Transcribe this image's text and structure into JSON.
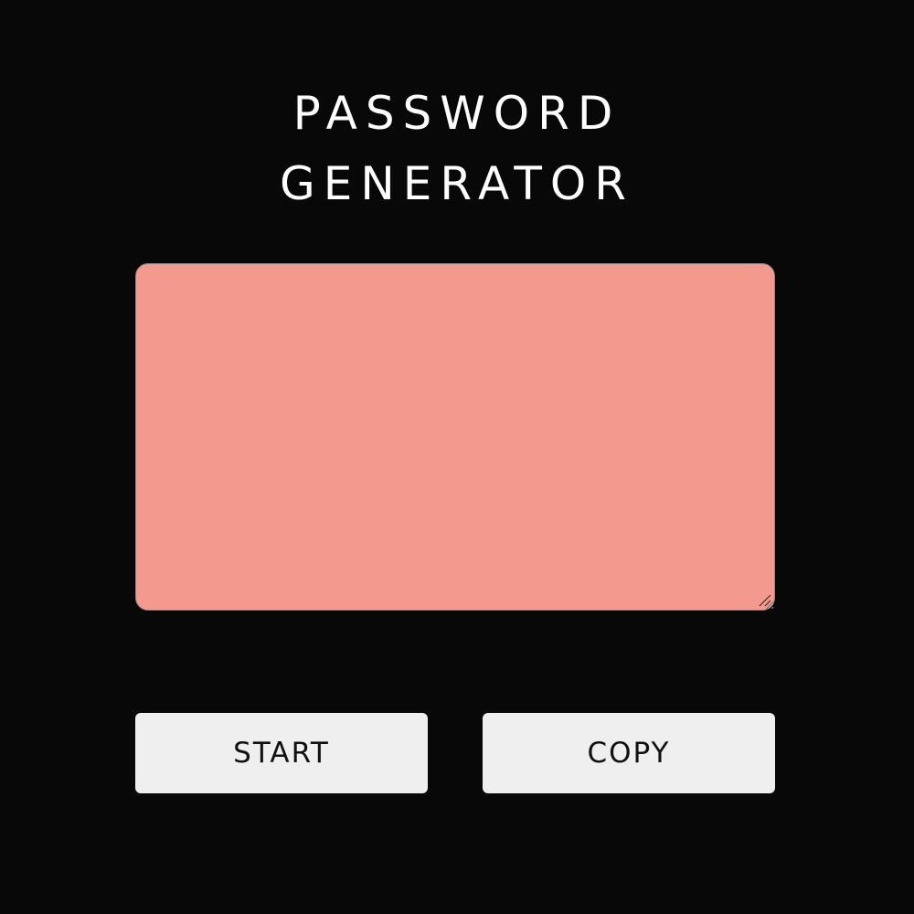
{
  "header": {
    "title_line1": "PASSWORD",
    "title_line2": "GENERATOR"
  },
  "output": {
    "value": "",
    "background_color": "#f3998d"
  },
  "actions": {
    "start_label": "START",
    "copy_label": "COPY"
  },
  "theme": {
    "page_background": "#080808",
    "button_background": "#efefef"
  }
}
